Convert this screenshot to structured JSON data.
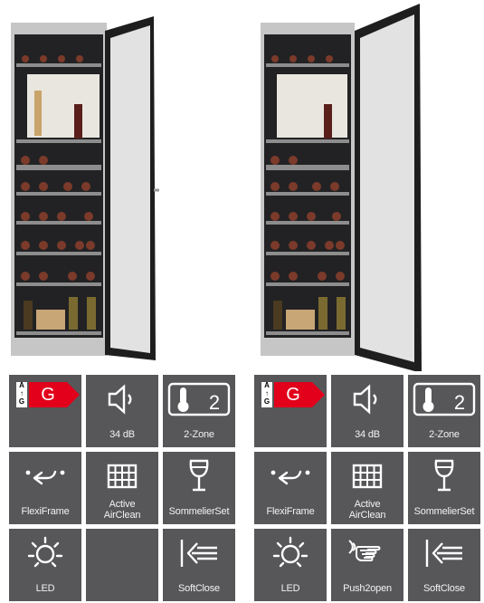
{
  "products": [
    {
      "features": [
        {
          "key": "energy",
          "label": "",
          "energy": {
            "scale_top": "A",
            "scale_bottom": "G",
            "class": "G"
          }
        },
        {
          "key": "noise",
          "label": "34 dB",
          "icon": "speaker-icon"
        },
        {
          "key": "zones",
          "label": "2-Zone",
          "icon": "thermometer-icon",
          "value": "2"
        },
        {
          "key": "flexiframe",
          "label": "FlexiFrame",
          "icon": "flexiframe-icon"
        },
        {
          "key": "airclean",
          "label": "Active\nAirClean",
          "icon": "grid-filter-icon"
        },
        {
          "key": "sommelier",
          "label": "SommelierSet",
          "icon": "wine-glass-icon"
        },
        {
          "key": "led",
          "label": "LED",
          "icon": "light-bulb-icon"
        },
        {
          "key": "empty",
          "label": "",
          "icon": ""
        },
        {
          "key": "softclose",
          "label": "SoftClose",
          "icon": "softclose-icon"
        }
      ]
    },
    {
      "features": [
        {
          "key": "energy",
          "label": "",
          "energy": {
            "scale_top": "A",
            "scale_bottom": "G",
            "class": "G"
          }
        },
        {
          "key": "noise",
          "label": "34 dB",
          "icon": "speaker-icon"
        },
        {
          "key": "zones",
          "label": "2-Zone",
          "icon": "thermometer-icon",
          "value": "2"
        },
        {
          "key": "flexiframe",
          "label": "FlexiFrame",
          "icon": "flexiframe-icon"
        },
        {
          "key": "airclean",
          "label": "Active\nAirClean",
          "icon": "grid-filter-icon"
        },
        {
          "key": "sommelier",
          "label": "SommelierSet",
          "icon": "wine-glass-icon"
        },
        {
          "key": "led",
          "label": "LED",
          "icon": "light-bulb-icon"
        },
        {
          "key": "push2open",
          "label": "Push2open",
          "icon": "push-hand-icon"
        },
        {
          "key": "softclose",
          "label": "SoftClose",
          "icon": "softclose-icon"
        }
      ]
    }
  ],
  "colors": {
    "tile": "#57575a",
    "energy_red": "#e2001a",
    "cabinet": "#c9c9c9",
    "interior": "#1d1d1f"
  }
}
